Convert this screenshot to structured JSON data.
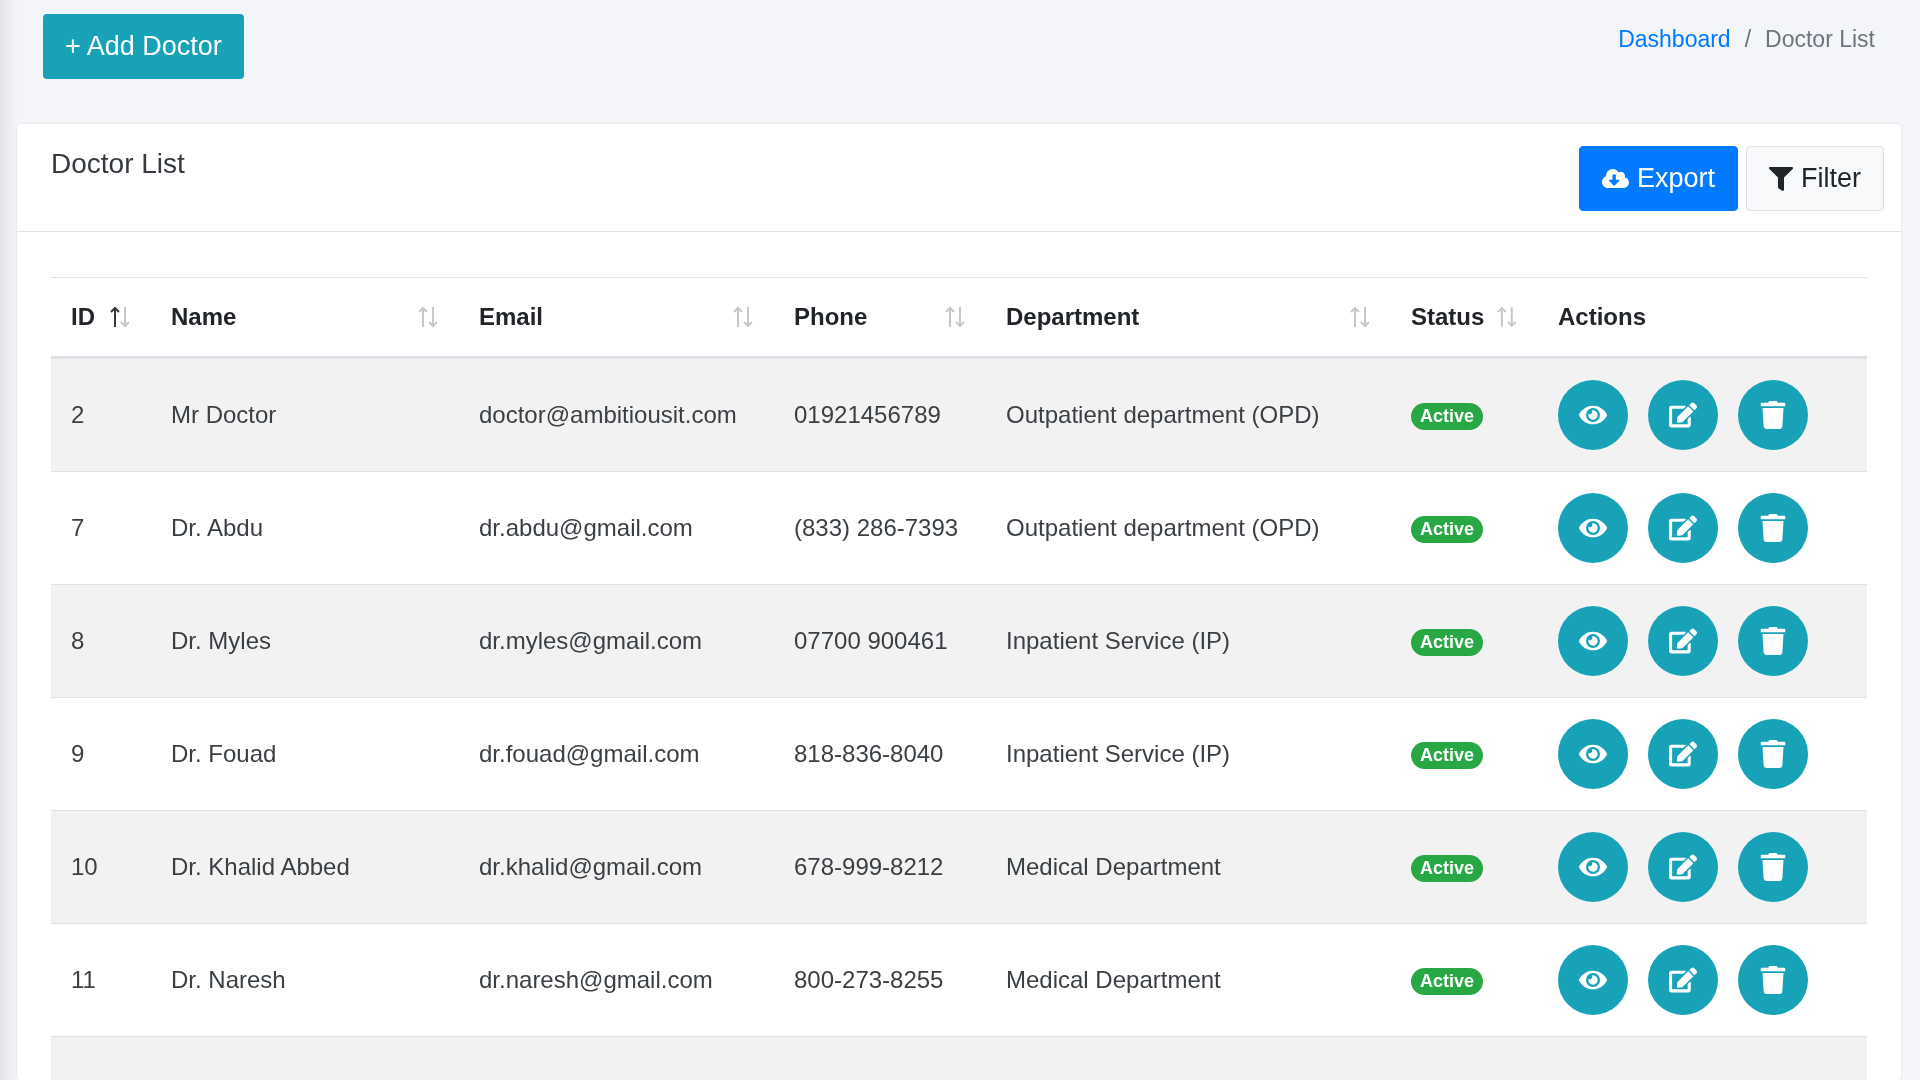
{
  "add_button": {
    "label": "+ Add Doctor"
  },
  "breadcrumb": {
    "separator": "/",
    "items": [
      {
        "label": "Dashboard",
        "kind": "link"
      },
      {
        "label": "Doctor List",
        "kind": "current"
      }
    ]
  },
  "card": {
    "title": "Doctor List",
    "buttons": [
      {
        "label": "Export",
        "kind": "primary"
      },
      {
        "label": "Filter",
        "kind": "light"
      }
    ]
  },
  "table": {
    "columns": [
      {
        "label": "ID",
        "sortable": true,
        "sorted_ascending": true
      },
      {
        "label": "Name",
        "sortable": true,
        "sorted_ascending": false
      },
      {
        "label": "Email",
        "sortable": true,
        "sorted_ascending": false
      },
      {
        "label": "Phone",
        "sortable": true,
        "sorted_ascending": false
      },
      {
        "label": "Department",
        "sortable": true,
        "sorted_ascending": false
      },
      {
        "label": "Status",
        "sortable": true,
        "sorted_ascending": false
      },
      {
        "label": "Actions",
        "sortable": false
      }
    ],
    "rows": [
      {
        "id": "2",
        "name": "Mr Doctor",
        "email": "doctor@ambitiousit.com",
        "phone": "01921456789",
        "department": "Outpatient department (OPD)",
        "status": "Active",
        "color": "#28a745"
      },
      {
        "id": "7",
        "name": "Dr. Abdu",
        "email": "dr.abdu@gmail.com",
        "phone": "(833) 286-7393",
        "department": "Outpatient department (OPD)",
        "status": "Active",
        "color": "#28a745"
      },
      {
        "id": "8",
        "name": "Dr. Myles",
        "email": "dr.myles@gmail.com",
        "phone": "07700 900461",
        "department": "Inpatient Service (IP)",
        "status": "Active",
        "color": "#28a745"
      },
      {
        "id": "9",
        "name": "Dr. Fouad",
        "email": "dr.fouad@gmail.com",
        "phone": "818-836-8040",
        "department": "Inpatient Service (IP)",
        "status": "Active",
        "color": "#28a745"
      },
      {
        "id": "10",
        "name": "Dr. Khalid Abbed",
        "email": "dr.khalid@gmail.com",
        "phone": "678-999-8212",
        "department": "Medical Department",
        "status": "Active",
        "color": "#28a745"
      },
      {
        "id": "11",
        "name": "Dr. Naresh",
        "email": "dr.naresh@gmail.com",
        "phone": "800-273-8255",
        "department": "Medical Department",
        "status": "Active",
        "color": "#28a745"
      }
    ]
  }
}
